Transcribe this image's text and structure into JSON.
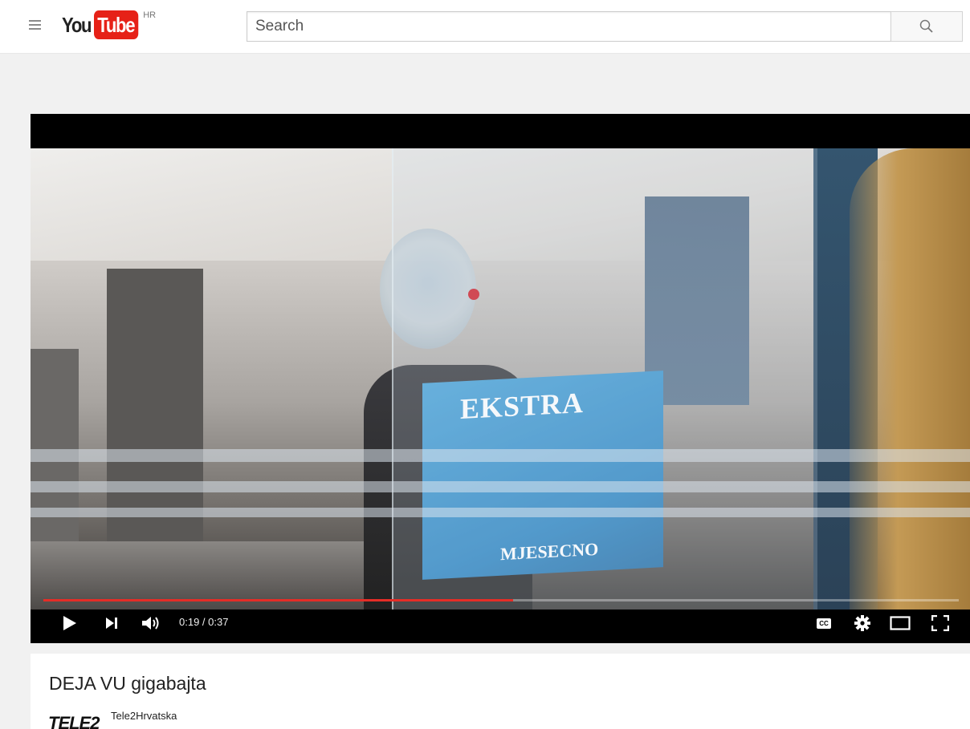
{
  "masthead": {
    "logo_you": "You",
    "logo_tube": "Tube",
    "region": "HR",
    "search_placeholder": "Search"
  },
  "player": {
    "current_time": "0:19",
    "duration": "0:37",
    "time_display": "0:19 / 0:37",
    "progress": 0.5135,
    "box_text_top": "EKSTRA",
    "box_text_bottom": "MJESECNO",
    "cc_label": "CC"
  },
  "video": {
    "title": "DEJA VU gigabajta",
    "channel_logo_text": "TELE2",
    "channel_name": "Tele2Hrvatska"
  },
  "colors": {
    "brand_red": "#e62117",
    "progress_red": "#e52d27",
    "background": "#f1f1f1"
  },
  "icons": [
    "menu-icon",
    "search-icon",
    "play-icon",
    "next-icon",
    "volume-icon",
    "captions-icon",
    "settings-icon",
    "theater-mode-icon",
    "fullscreen-icon"
  ]
}
